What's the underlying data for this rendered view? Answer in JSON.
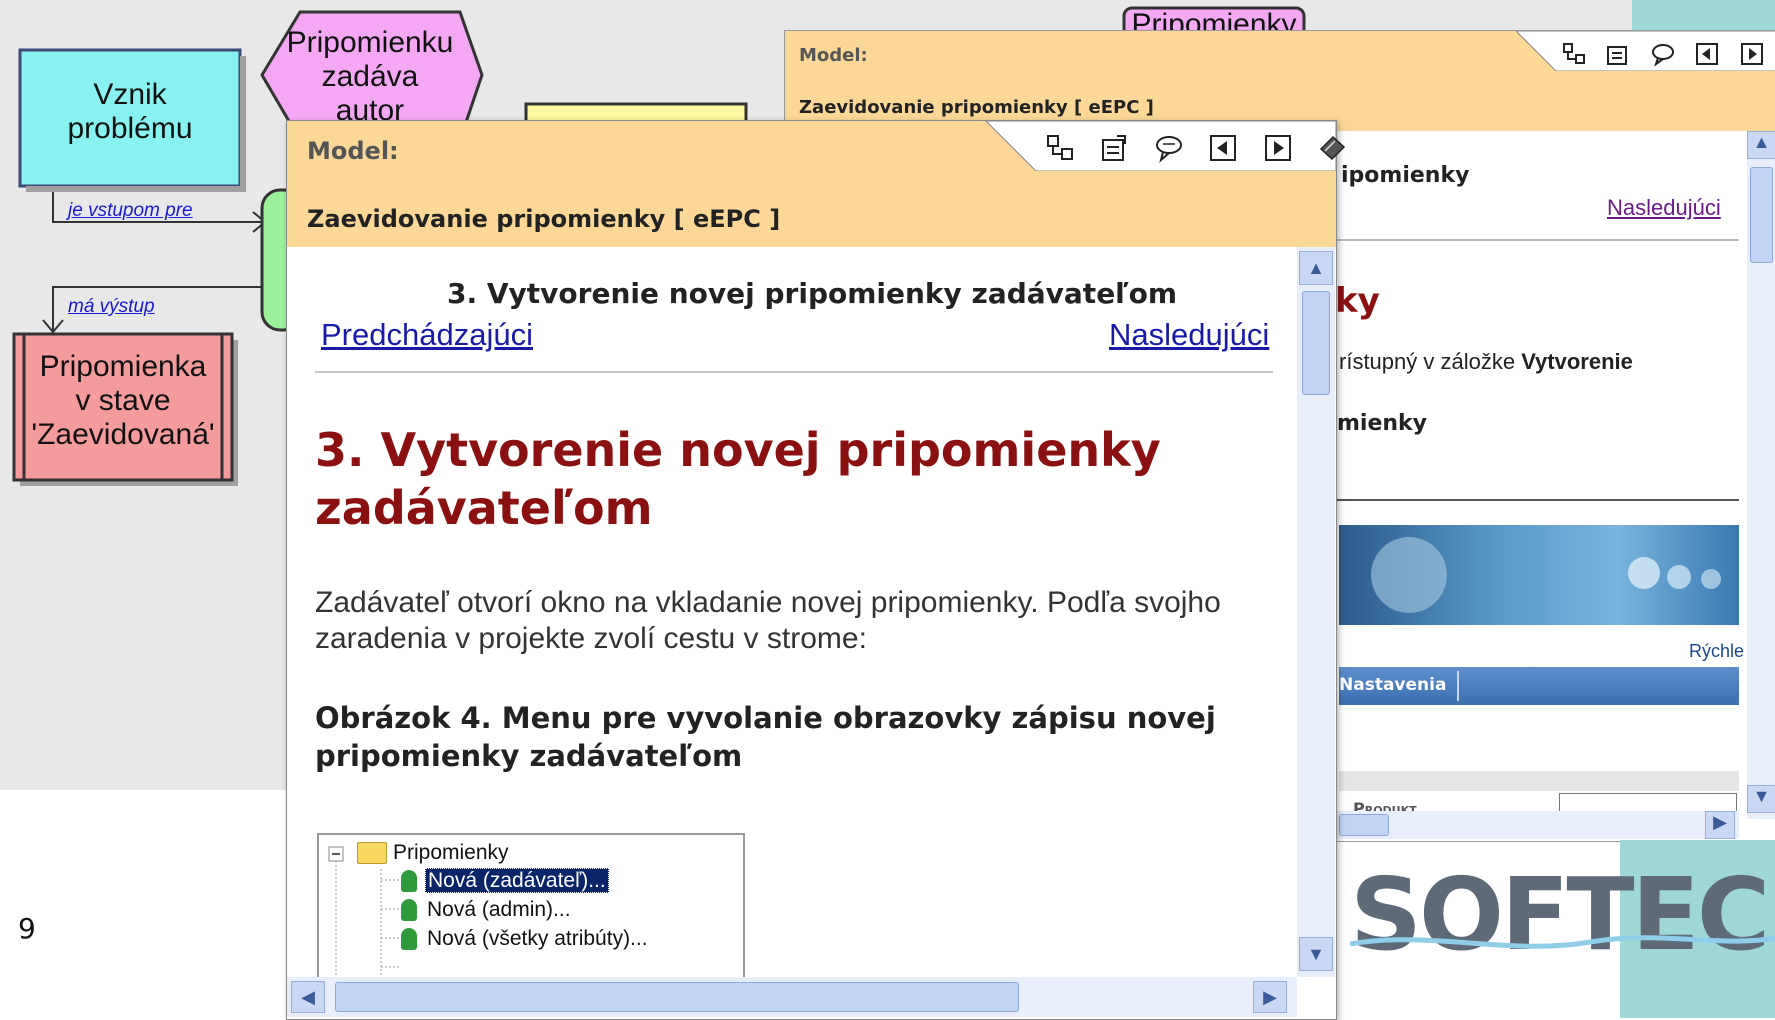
{
  "page_number": "9",
  "diagram": {
    "vznik_label": "Vznik\nproblému",
    "hex_label": "Pripomienku\nzadáva\nautor",
    "pripomienka_label": "Pripomienka\nv stave\n'Zaevidovaná'",
    "top_fragment": "Pripomienky",
    "edge_input": "je vstupom pre",
    "edge_output": "má výstup"
  },
  "colors": {
    "vznik_fill": "#88f2f2",
    "hex_fill": "#f4a8f4",
    "pripomienka_fill": "#f49c9c",
    "green_fill": "#9cf09c",
    "yellow_fill": "#fcf8a0",
    "header_fill": "#fcd898",
    "link": "#1a1aa8",
    "heading": "#8b1010",
    "accent_teal": "#9fd6d6"
  },
  "back_window": {
    "model_label": "Model:",
    "title": "Zaevidovanie pripomienky [ eEPC ]",
    "frag_heading_small": "ipomienky",
    "next_link": "Nasledujúci",
    "frag_big": "ky",
    "frag_text": "rístupný v záložke ",
    "frag_text_bold": "Vytvorenie",
    "frag_bold2": "mienky",
    "banner_link": "Rýchle",
    "nav_tab": "Nastavenia",
    "produkt_label": "Produkt"
  },
  "front_window": {
    "model_label": "Model:",
    "title": "Zaevidovanie pripomienky [ eEPC ]",
    "subheading": "3. Vytvorenie novej pripomienky zadávateľom",
    "prev_link": "Predchádzajúci",
    "next_link": "Nasledujúci",
    "heading_line1": "3. Vytvorenie novej pripomienky",
    "heading_line2": "zadávateľom",
    "paragraph_line1": "Zadávateľ otvorí okno na vkladanie novej pripomienky. Podľa svojho",
    "paragraph_line2": "zaradenia v projekte zvolí cestu v strome:",
    "figure_caption_line1": "Obrázok 4. Menu pre vyvolanie obrazovky zápisu novej",
    "figure_caption_line2": "pripomienky zadávateľom",
    "tree": {
      "root": "Pripomienky",
      "items": [
        "Nová (zadávateľ)...",
        "Nová (admin)...",
        "Nová (všetky atribúty)..."
      ]
    }
  },
  "toolbar_icons": [
    "hierarchy-icon",
    "properties-icon",
    "comment-icon",
    "back-icon",
    "forward-icon",
    "book-icon"
  ],
  "logo_text": "SOFTEC"
}
